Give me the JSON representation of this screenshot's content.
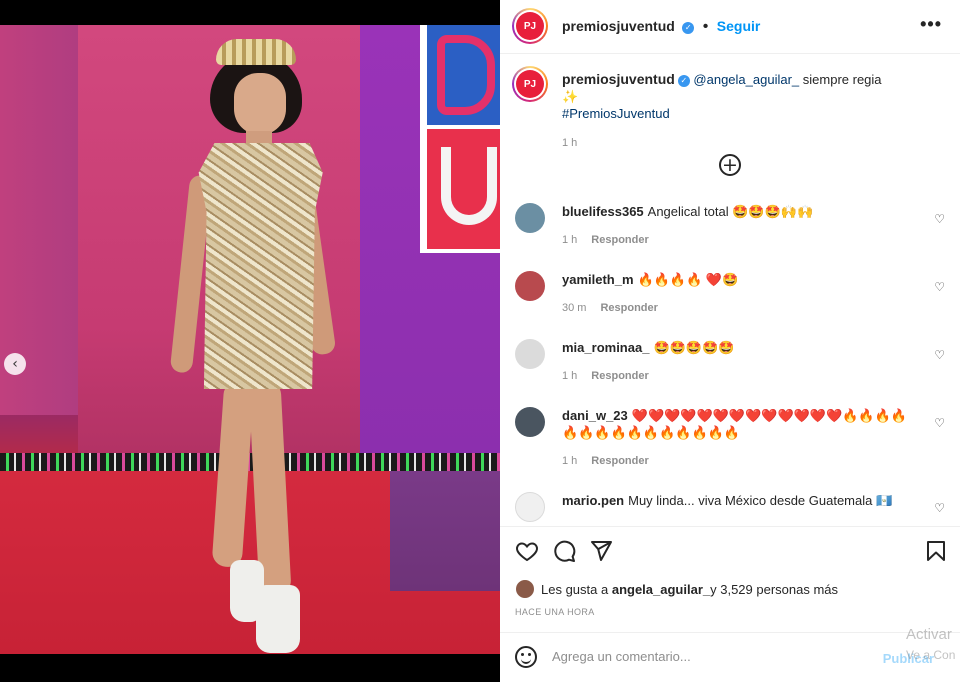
{
  "post": {
    "account": "premiosjuventud",
    "follow_label": "Seguir",
    "more_label": "•••",
    "logo_text": "PJ"
  },
  "caption": {
    "user": "premiosjuventud",
    "mention": "@angela_aguilar_",
    "text": " siempre regia ✨",
    "hashtag": "#PremiosJuventud",
    "time": "1 h"
  },
  "load_more_icon": "plus-circle-icon",
  "comments": [
    {
      "user": "bluelifess365",
      "text": "Angelical total 🤩🤩🤩🙌🙌",
      "time": "1 h",
      "reply": "Responder",
      "avatar_color": "#6b8fa3"
    },
    {
      "user": "yamileth_m",
      "text": "🔥🔥🔥🔥 ❤️🤩",
      "time": "30 m",
      "reply": "Responder",
      "avatar_color": "#b84a4e"
    },
    {
      "user": "mia_rominaa_",
      "text": "🤩🤩🤩🤩🤩",
      "time": "1 h",
      "reply": "Responder",
      "avatar_color": "#dbdbdb"
    },
    {
      "user": "dani_w_23",
      "text": "❤️❤️❤️❤️❤️❤️❤️❤️❤️❤️❤️❤️❤️🔥🔥🔥🔥🔥🔥🔥🔥🔥🔥🔥🔥🔥🔥🔥",
      "time": "1 h",
      "reply": "Responder",
      "avatar_color": "#4a5560"
    },
    {
      "user": "mario.pen",
      "text": "Muy linda... viva México desde Guatemala 🇬🇹",
      "time": "",
      "reply": "",
      "avatar_color": "#f0f0f0"
    }
  ],
  "actions": {
    "like_icon": "heart-icon",
    "comment_icon": "comment-icon",
    "share_icon": "send-icon",
    "save_icon": "bookmark-icon"
  },
  "likes": {
    "prefix": "Les gusta a ",
    "user": "angela_aguilar_",
    "suffix": " y 3,529 personas más"
  },
  "posted_ago": "HACE UNA HORA",
  "add_comment": {
    "placeholder": "Agrega un comentario...",
    "publish": "Publicar"
  },
  "carousel": {
    "prev_label": "‹",
    "total": 2,
    "active": 2
  },
  "os_watermark": {
    "line1": "Activar",
    "line2": "Ve a Con"
  },
  "colors": {
    "accent": "#0095f6",
    "verified": "#3897f0",
    "brand": "#e81f3b"
  }
}
